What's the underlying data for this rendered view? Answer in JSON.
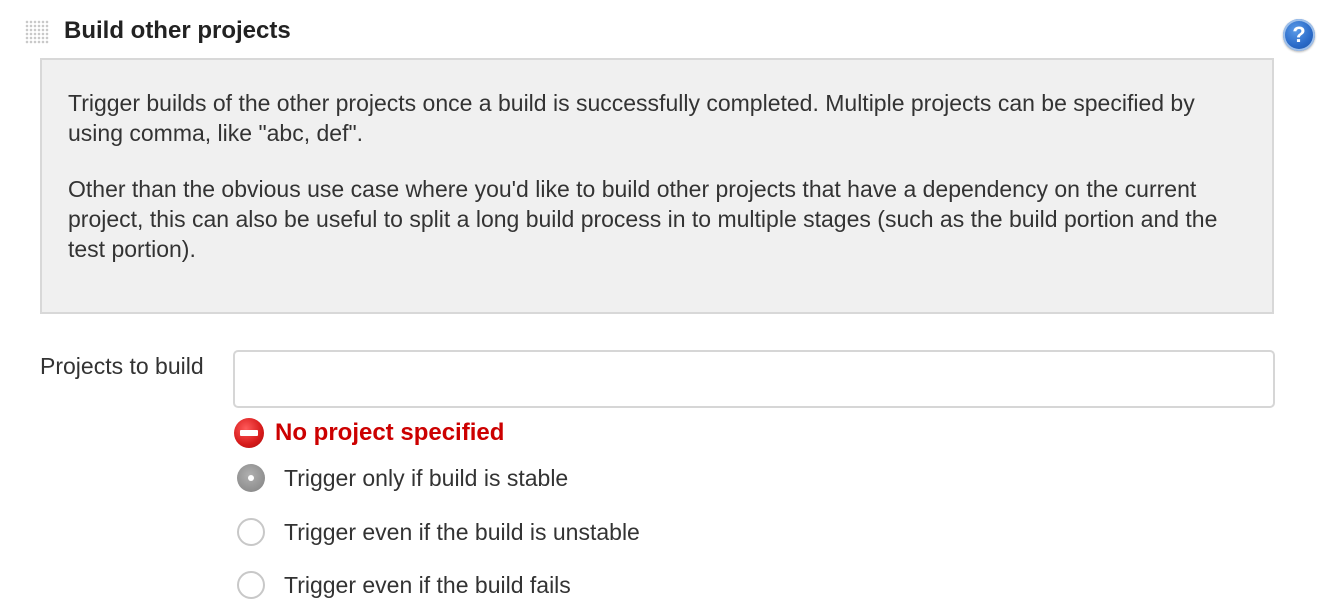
{
  "section": {
    "title": "Build other projects",
    "help_icon": "question-mark-icon"
  },
  "help_text": {
    "paragraph_1": "Trigger builds of the other projects once a build is successfully completed. Multiple projects can be specified by using comma, like \"abc, def\".",
    "paragraph_2": "Other than the obvious use case where you'd like to build other projects that have a dependency on the current project, this can also be useful to split a long build process in to multiple stages (such as the build portion and the test portion)."
  },
  "projects_field": {
    "label": "Projects to build",
    "value": "",
    "placeholder": ""
  },
  "validation": {
    "error_icon": "error-minus-icon",
    "error_message": "No project specified",
    "error_color": "#cc0000"
  },
  "trigger_options": [
    {
      "label": "Trigger only if build is stable",
      "selected": true
    },
    {
      "label": "Trigger even if the build is unstable",
      "selected": false
    },
    {
      "label": "Trigger even if the build fails",
      "selected": false
    }
  ],
  "colors": {
    "help_background": "#f0f0f0",
    "help_icon_blue": "#2a6ac8"
  }
}
